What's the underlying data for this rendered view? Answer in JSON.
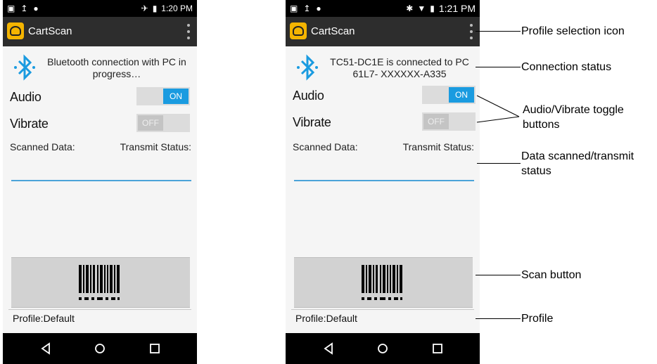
{
  "phones": [
    {
      "status": {
        "left_icons": [
          "image-icon",
          "upload-icon",
          "android-icon"
        ],
        "right_icons": [
          "airplane-icon",
          "battery-icon"
        ],
        "time": "1:20 PM"
      },
      "app_title": "CartScan",
      "connection_status": "Bluetooth connection with PC in progress…",
      "audio_label": "Audio",
      "audio_state": "ON",
      "vibrate_label": "Vibrate",
      "vibrate_state": "OFF",
      "scanned_data_label": "Scanned Data:",
      "transmit_status_label": "Transmit Status:",
      "profile": "Profile:Default"
    },
    {
      "status": {
        "left_icons": [
          "image-icon",
          "upload-icon",
          "android-icon"
        ],
        "right_icons": [
          "bluetooth-icon",
          "wifi-icon",
          "battery-icon"
        ],
        "time": "1:21 PM"
      },
      "app_title": "CartScan",
      "connection_status": "TC51-DC1E is connected to PC 61L7- XXXXXX-A335",
      "audio_label": "Audio",
      "audio_state": "ON",
      "vibrate_label": "Vibrate",
      "vibrate_state": "OFF",
      "scanned_data_label": "Scanned Data:",
      "transmit_status_label": "Transmit Status:",
      "profile": "Profile:Default"
    }
  ],
  "annotations": {
    "profile_selection": "Profile selection icon",
    "connection_status": "Connection status",
    "toggle_buttons": "Audio/Vibrate toggle buttons",
    "data_scanned": "Data scanned/transmit status",
    "scan_button": "Scan button",
    "profile": "Profile"
  },
  "colors": {
    "accent": "#1a9be0",
    "appbar": "#2d2d2d",
    "logo": "#f4b400"
  }
}
